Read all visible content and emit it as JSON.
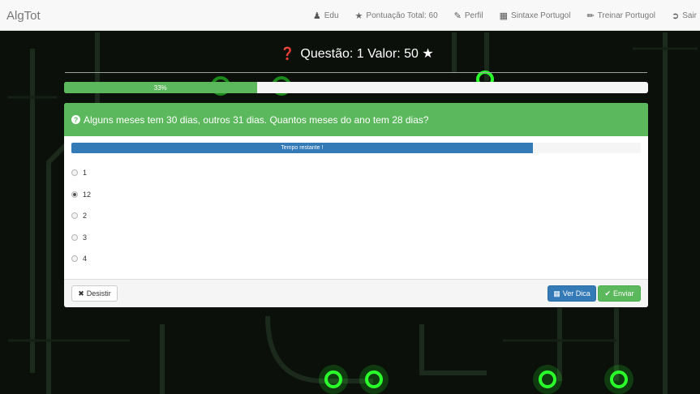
{
  "app": {
    "brand": "AlgTot"
  },
  "nav": {
    "user": "Edu",
    "pontuacao": "Pontuação Total: 60",
    "perfil": "Perfil",
    "sintaxe": "Sintaxe Portugol",
    "treinar": "Treinar Portugol",
    "sair": "Sair"
  },
  "question": {
    "title": "Questão: 1 Valor: 50",
    "progress_label": "33%",
    "progress_percent": 33,
    "text": "Alguns meses tem 30 dias, outros 31 dias. Quantos meses do ano tem 28 dias?",
    "timer_label": "Tempo restante !",
    "timer_percent": 81,
    "options": [
      {
        "label": "1",
        "checked": false
      },
      {
        "label": "12",
        "checked": true
      },
      {
        "label": "2",
        "checked": false
      },
      {
        "label": "3",
        "checked": false
      },
      {
        "label": "4",
        "checked": false
      }
    ]
  },
  "buttons": {
    "desistir": "Desistir",
    "ver_dica": "Ver Dica",
    "enviar": "Enviar"
  },
  "colors": {
    "success": "#5cb85c",
    "primary": "#337ab7",
    "circuit": "#22ff22"
  }
}
